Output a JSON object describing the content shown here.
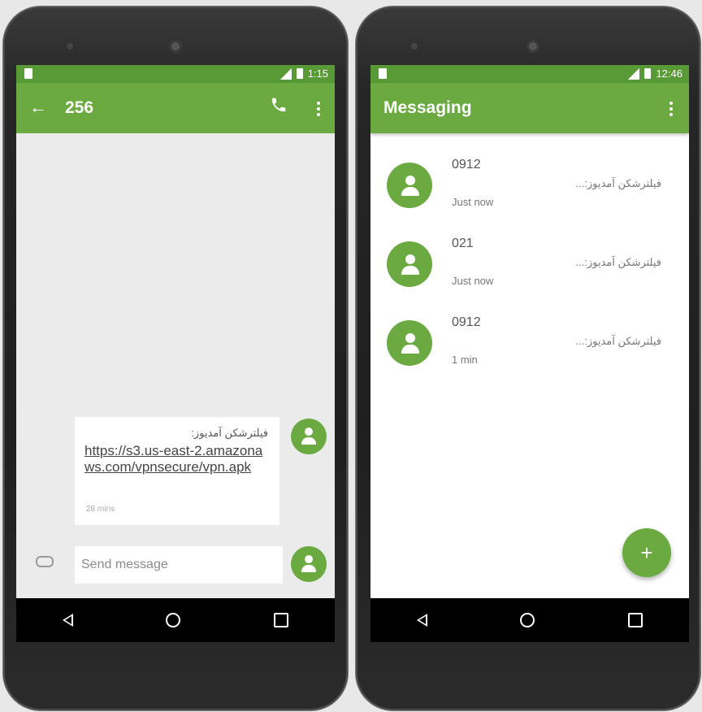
{
  "left_phone": {
    "status_time": "1:15",
    "title": "256",
    "message": {
      "sender_text": "فیلترشکن آمدیوز:",
      "link": "https://s3.us-east-2.amazonaws.com/vpnsecure/vpn.apk",
      "time": "28 mins"
    },
    "compose_placeholder": "Send message"
  },
  "right_phone": {
    "status_time": "12:46",
    "title": "Messaging",
    "conversations": [
      {
        "name": "0912",
        "time": "Just now",
        "snippet": "فیلترشکن آمدیوز:..."
      },
      {
        "name": "021",
        "time": "Just now",
        "snippet": "فیلترشکن آمدیوز:..."
      },
      {
        "name": "0912",
        "time": "1 min",
        "snippet": "فیلترشکن آمدیوز:..."
      }
    ],
    "fab_label": "+"
  },
  "colors": {
    "accent": "#6aaa40",
    "statusbar": "#579a36"
  }
}
